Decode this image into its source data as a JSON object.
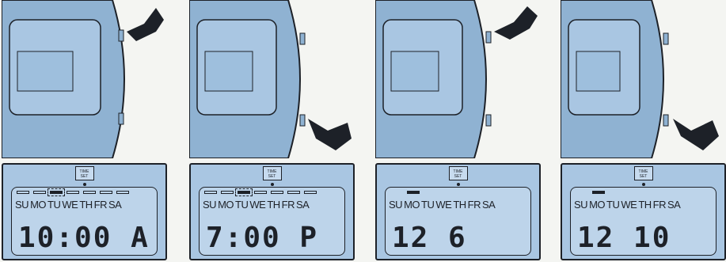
{
  "panels": [
    {
      "mode": {
        "line1": "TIME",
        "line2": "SET"
      },
      "days": [
        "SU",
        "MO",
        "TU",
        "WE",
        "TH",
        "FR",
        "SA"
      ],
      "active_day": 2,
      "show_bars": true,
      "hour": "10",
      "sep": ":",
      "minute": "00",
      "ampm": "A",
      "blink": "minute",
      "buttons_pressed": [
        "top"
      ]
    },
    {
      "mode": {
        "line1": "TIME",
        "line2": "SET"
      },
      "days": [
        "SU",
        "MO",
        "TU",
        "WE",
        "TH",
        "FR",
        "SA"
      ],
      "active_day": 2,
      "show_bars": true,
      "hour": "7",
      "sep": ":",
      "minute": "00",
      "ampm": "P",
      "blink": "ampm",
      "buttons_pressed": [
        "bottom"
      ]
    },
    {
      "mode": {
        "line1": "TIME",
        "line2": "SET"
      },
      "days": [
        "SU",
        "MO",
        "TU",
        "WE",
        "TH",
        "FR",
        "SA"
      ],
      "active_day": 1,
      "show_bars": false,
      "hour": "12",
      "sep": "",
      "minute": "6",
      "ampm": "",
      "blink": "minute",
      "buttons_pressed": [
        "top",
        "bottom"
      ]
    },
    {
      "mode": {
        "line1": "TIME",
        "line2": "SET"
      },
      "days": [
        "SU",
        "MO",
        "TU",
        "WE",
        "TH",
        "FR",
        "SA"
      ],
      "active_day": 1,
      "show_bars": false,
      "hour": "12",
      "sep": "",
      "minute": "10",
      "ampm": "",
      "blink": "minute",
      "buttons_pressed": [
        "bottom"
      ]
    }
  ],
  "colors": {
    "lcd": "#a9c6e2",
    "ink": "#1d2128",
    "case": "#8fb2d2",
    "paper": "#f4f5f2"
  }
}
